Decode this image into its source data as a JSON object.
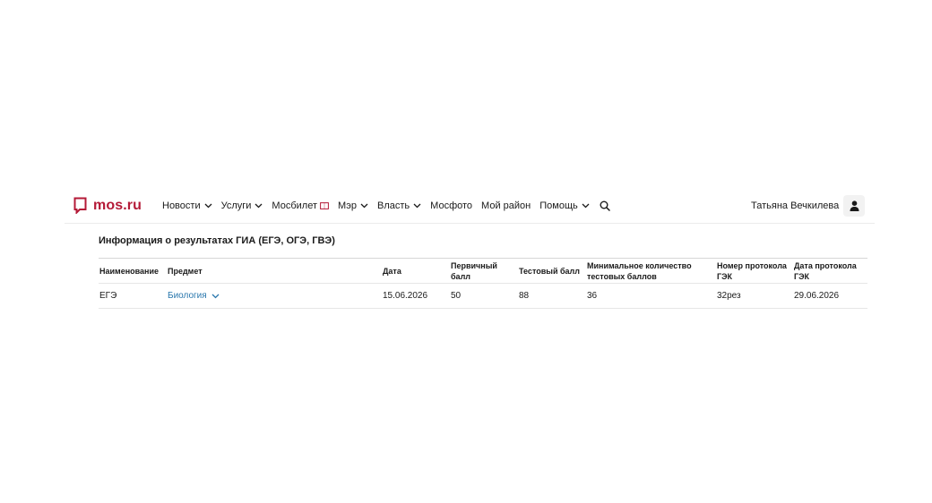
{
  "header": {
    "logo_text": "mos.ru",
    "nav": [
      {
        "label": "Новости",
        "has_dropdown": true
      },
      {
        "label": "Услуги",
        "has_dropdown": true
      },
      {
        "label": "Мосбилет",
        "has_dropdown": false
      },
      {
        "label": "Мэр",
        "has_dropdown": true
      },
      {
        "label": "Власть",
        "has_dropdown": true
      },
      {
        "label": "Мосфото",
        "has_dropdown": false
      },
      {
        "label": "Мой район",
        "has_dropdown": false
      },
      {
        "label": "Помощь",
        "has_dropdown": true
      }
    ],
    "user_name": "Татьяна Вечкилева"
  },
  "section": {
    "title": "Информация о результатах ГИА (ЕГЭ, ОГЭ, ГВЭ)"
  },
  "table": {
    "headers": [
      "Наименование",
      "Предмет",
      "Дата",
      "Первичный балл",
      "Тестовый балл",
      "Минимальное количество тестовых баллов",
      "Номер протокола ГЭК",
      "Дата протокола ГЭК"
    ],
    "rows": [
      {
        "name": "ЕГЭ",
        "subject": "Биология",
        "date": "15.06.2026",
        "primary_score": "50",
        "test_score": "88",
        "min_score": "36",
        "protocol_number": "32рез",
        "protocol_date": "29.06.2026"
      }
    ]
  },
  "colors": {
    "brand": "#b41a37",
    "link": "#2a77ad",
    "text": "#1a1a1a"
  },
  "icons": {
    "logo": "speech-bubble-icon",
    "dropdown": "chevron-down-icon",
    "mosbilet": "ticket-icon",
    "search": "search-icon",
    "user": "user-icon"
  }
}
